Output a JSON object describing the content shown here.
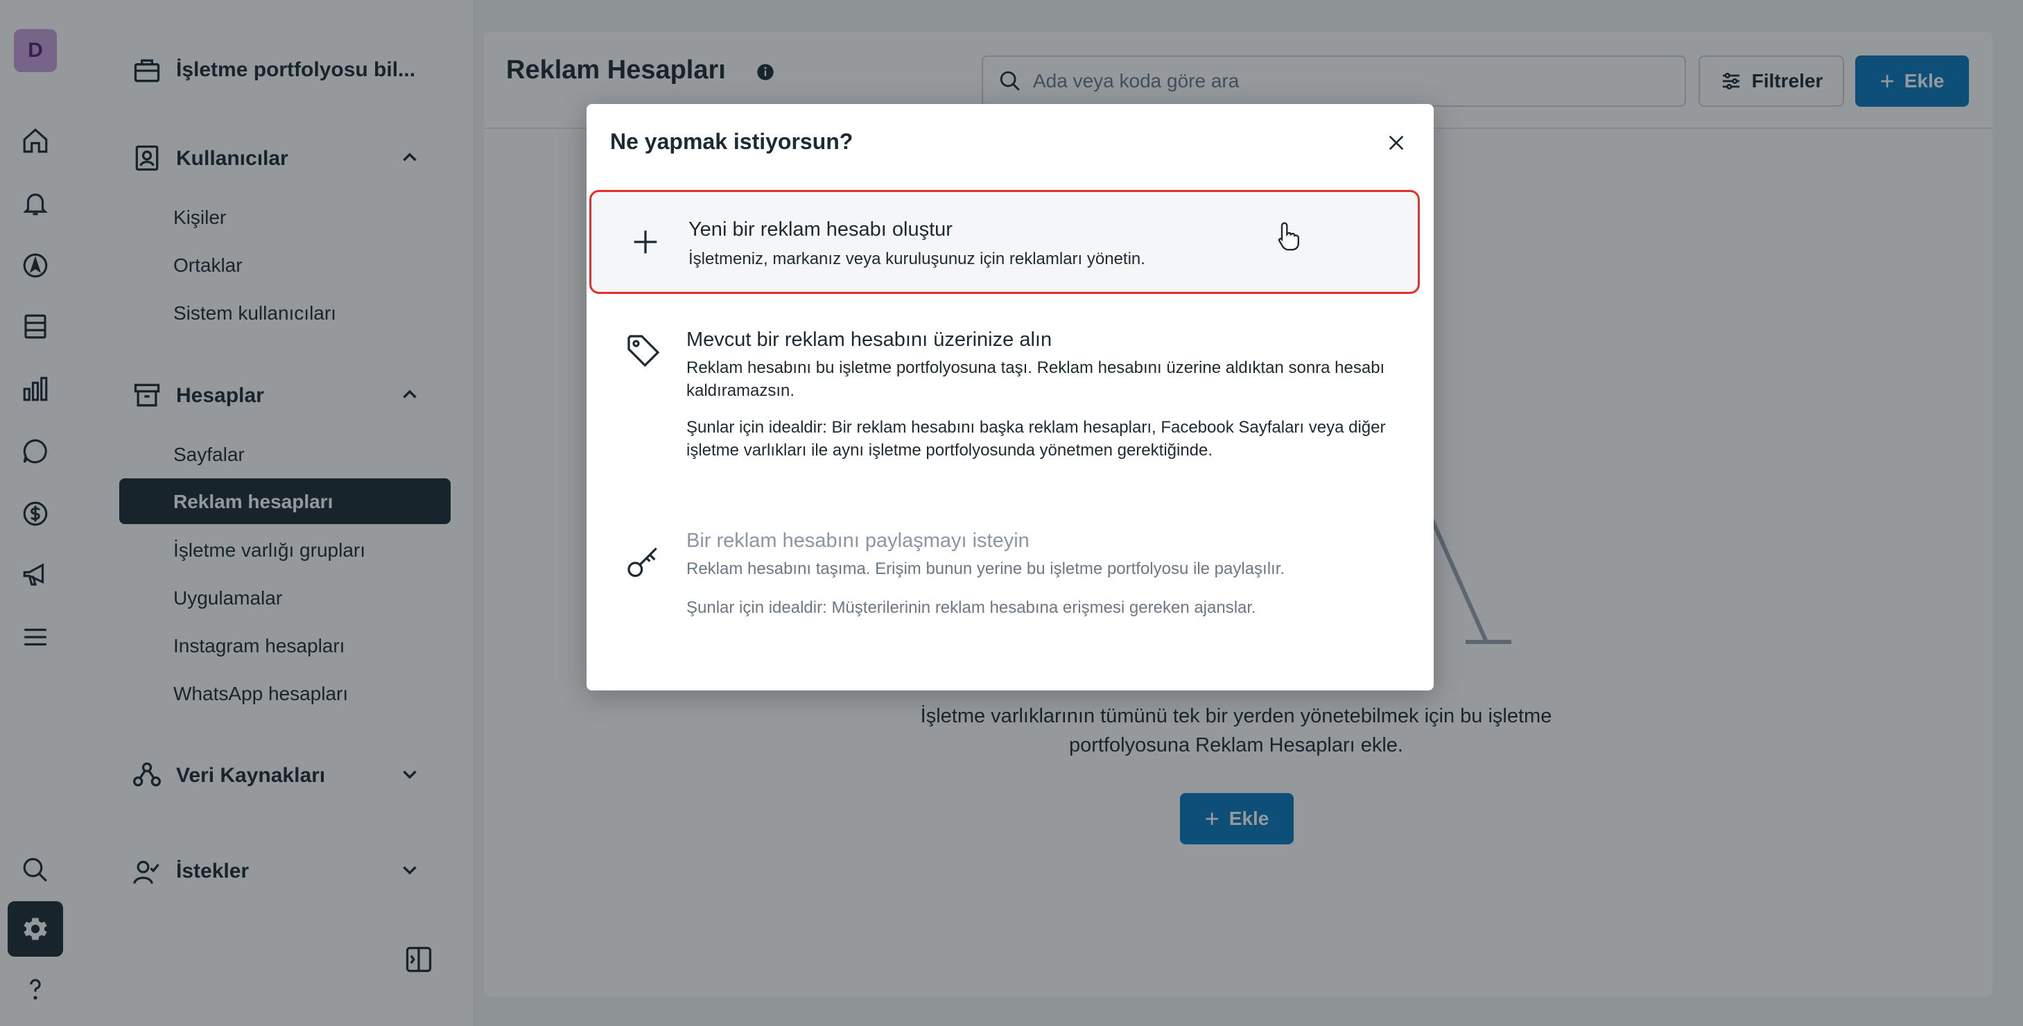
{
  "rail": {
    "avatar_letter": "D"
  },
  "sidenav": {
    "portfolio_label": "İşletme portfolyosu bil...",
    "users_section": "Kullanıcılar",
    "users_items": [
      "Kişiler",
      "Ortaklar",
      "Sistem kullanıcıları"
    ],
    "accounts_section": "Hesaplar",
    "accounts_items": [
      "Sayfalar",
      "Reklam hesapları",
      "İşletme varlığı grupları",
      "Uygulamalar",
      "Instagram hesapları",
      "WhatsApp hesapları"
    ],
    "active_item": "Reklam hesapları",
    "data_sources_section": "Veri Kaynakları",
    "requests_section": "İstekler"
  },
  "main": {
    "title": "Reklam Hesapları",
    "search_placeholder": "Ada veya koda göre ara",
    "filter_label": "Filtreler",
    "add_label": "Ekle",
    "empty_desc": "İşletme varlıklarının tümünü tek bir yerden yönetebilmek için bu işletme portfolyosuna Reklam Hesapları ekle.",
    "empty_add_label": "Ekle"
  },
  "modal": {
    "title": "Ne yapmak istiyorsun?",
    "options": [
      {
        "title": "Yeni bir reklam hesabı oluştur",
        "desc": "İşletmeniz, markanız veya kuruluşunuz için reklamları yönetin."
      },
      {
        "title": "Mevcut bir reklam hesabını üzerinize alın",
        "desc": "Reklam hesabını bu işletme portfolyosuna taşı. Reklam hesabını üzerine aldıktan sonra hesabı kaldıramazsın.",
        "ideal": "Şunlar için idealdir: Bir reklam hesabını başka reklam hesapları, Facebook Sayfaları veya diğer işletme varlıkları ile aynı işletme portfolyosunda yönetmen gerektiğinde."
      },
      {
        "title": "Bir reklam hesabını paylaşmayı isteyin",
        "desc": "Reklam hesabını taşıma. Erişim bunun yerine bu işletme portfolyosu ile paylaşılır.",
        "ideal": "Şunlar için idealdir: Müşterilerinin reklam hesabına erişmesi gereken ajanslar."
      }
    ]
  },
  "colors": {
    "primary": "#0a78be",
    "dark": "#1c2b33",
    "highlight": "#e0322a"
  }
}
